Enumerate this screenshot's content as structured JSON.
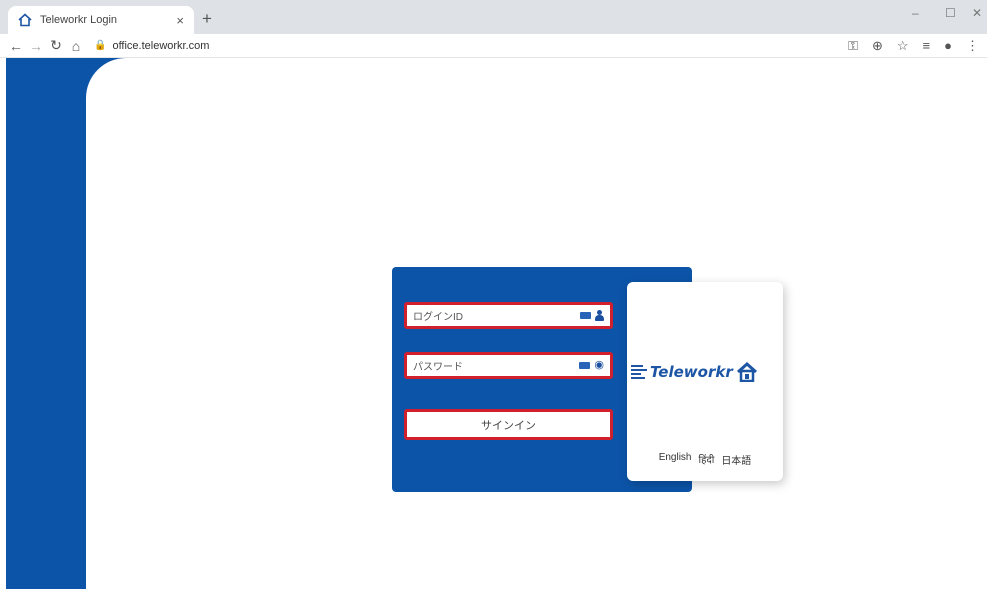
{
  "browser": {
    "tab_title": "Teleworkr Login",
    "tab_close": "×",
    "new_tab": "+",
    "url": "office.teleworkr.com",
    "minimize": "–",
    "maximize": "☐",
    "close": "✕"
  },
  "login": {
    "id_placeholder": "ログインID",
    "password_placeholder": "パスワード",
    "signin_label": "サインイン"
  },
  "brand": {
    "logo_text": "Teleworkr",
    "languages": [
      "English",
      "हिंदी",
      "日本語"
    ]
  },
  "colors": {
    "brand_blue": "#0c54a8",
    "highlight_red": "#d0202e"
  },
  "icons": {
    "id_field": [
      "keyboard-icon",
      "user-icon"
    ],
    "password_field": [
      "keyboard-icon",
      "eye-icon"
    ]
  }
}
